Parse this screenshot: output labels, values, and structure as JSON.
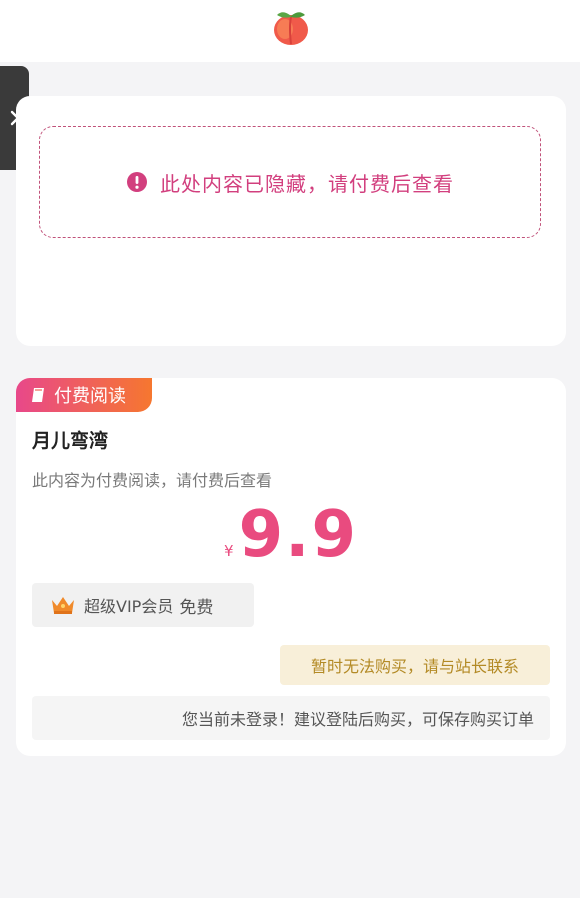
{
  "colors": {
    "accent": "#e94b7f",
    "notice_text": "#b38a25",
    "notice_bg": "#f8efd9"
  },
  "header": {
    "logo_icon": "peach-icon"
  },
  "sidebar_toggle": {
    "icon": "chevron-right-icon"
  },
  "hidden_content": {
    "icon": "exclamation-circle-icon",
    "text": "此处内容已隐藏，请付费后查看"
  },
  "paid_card": {
    "badge_icon": "book-icon",
    "badge_label": "付费阅读",
    "title": "月儿弯湾",
    "description": "此内容为付费阅读，请付费后查看",
    "currency": "¥",
    "price": "9.9",
    "vip": {
      "icon": "crown-icon",
      "label": "超级VIP会员",
      "free": "免费"
    },
    "purchase_notice": "暂时无法购买，请与站长联系",
    "login_tip": "您当前未登录！建议登陆后购买，可保存购买订单"
  }
}
